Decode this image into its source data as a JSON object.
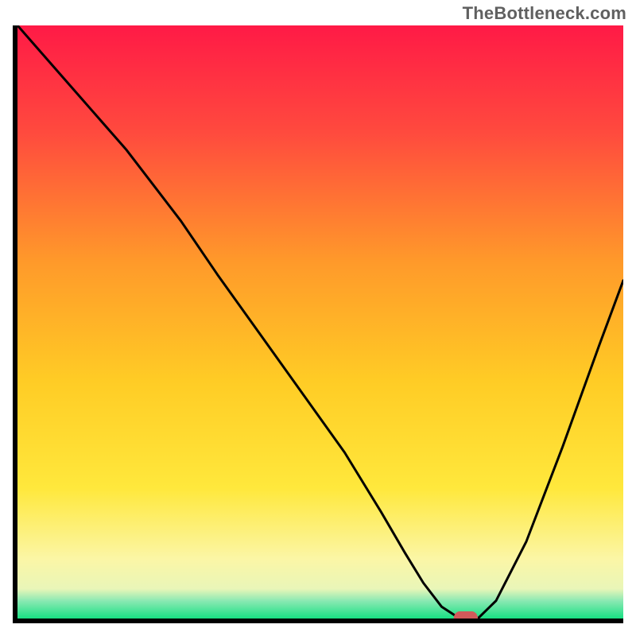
{
  "watermark": "TheBottleneck.com",
  "chart_data": {
    "type": "line",
    "title": "",
    "xlabel": "",
    "ylabel": "",
    "xlim": [
      0,
      100
    ],
    "ylim": [
      0,
      100
    ],
    "grid": false,
    "legend": false,
    "series": [
      {
        "name": "bottleneck-curve",
        "x": [
          0,
          6,
          12,
          18,
          24,
          27,
          33,
          40,
          47,
          54,
          60,
          64,
          67,
          70,
          73,
          76,
          79,
          84,
          90,
          96,
          100
        ],
        "y": [
          100,
          93,
          86,
          79,
          71,
          67,
          58,
          48,
          38,
          28,
          18,
          11,
          6,
          2,
          0,
          0,
          3,
          13,
          29,
          46,
          57
        ]
      }
    ],
    "marker": {
      "x": 74,
      "y": 0,
      "w": 4.0,
      "h": 2.4
    },
    "colors": {
      "curve": "#000000",
      "marker": "#d15a5a",
      "gradient_top": "#ff1a46",
      "gradient_bottom": "#18e083"
    }
  }
}
